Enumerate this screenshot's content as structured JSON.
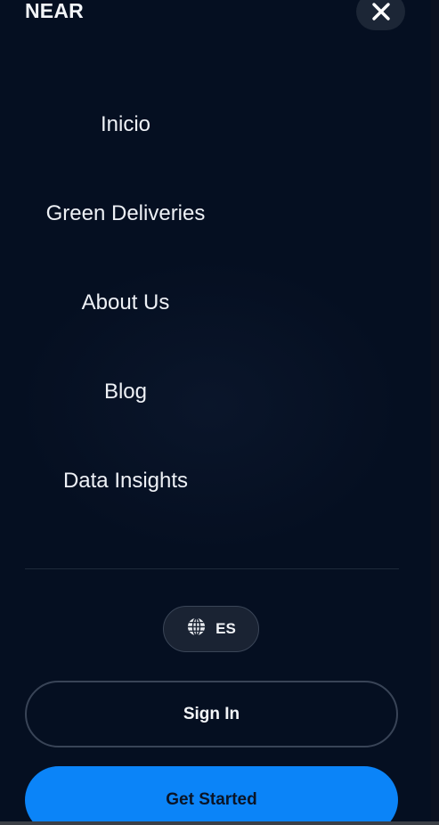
{
  "header": {
    "brand": "NEAR",
    "close_icon": "close-icon"
  },
  "nav": {
    "items": [
      {
        "label": "Inicio"
      },
      {
        "label": "Green Deliveries"
      },
      {
        "label": "About Us"
      },
      {
        "label": "Blog"
      },
      {
        "label": "Data Insights"
      }
    ]
  },
  "language": {
    "icon": "globe-icon",
    "label": "ES"
  },
  "actions": {
    "sign_in": "Sign In",
    "get_started": "Get Started"
  },
  "colors": {
    "background": "#050f21",
    "accent": "#0b84f8",
    "surface": "#1c2636"
  }
}
